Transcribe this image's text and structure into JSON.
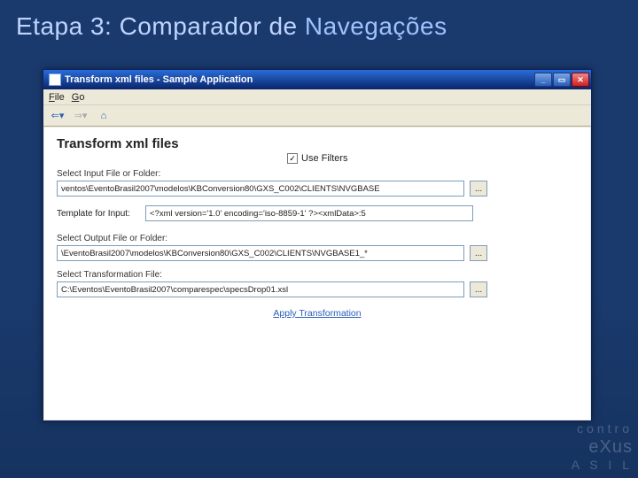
{
  "slide": {
    "title_prefix": "Etapa 3: Comparador de ",
    "title_accent": "Navegações"
  },
  "window": {
    "title": "Transform xml files - Sample Application",
    "menu": {
      "file": "File",
      "go": "Go"
    },
    "toolbar": {
      "back": "⇐",
      "fwd": "⇒",
      "home": "⌂"
    }
  },
  "form": {
    "heading": "Transform xml files",
    "use_filters_label": "Use Filters",
    "use_filters_checked": "✓",
    "input_label": "Select Input File or Folder:",
    "input_value": "ventos\\EventoBrasil2007\\modelos\\KBConversion80\\GXS_C002\\CLIENTS\\NVGBASE",
    "template_label": "Template for Input:",
    "template_value": "<?xml version='1.0' encoding='iso-8859-1' ?><xmlData>:5",
    "output_label": "Select Output File or Folder:",
    "output_value": "\\EventoBrasil2007\\modelos\\KBConversion80\\GXS_C002\\CLIENTS\\NVGBASE1_*",
    "transform_label": "Select Transformation File:",
    "transform_value": "C:\\Eventos\\EventoBrasil2007\\comparespec\\specsDrop01.xsl",
    "apply_label": "Apply Transformation",
    "browse": "..."
  },
  "watermark": {
    "line1": "contro",
    "line2": "eXus",
    "line3": "A S I L"
  }
}
